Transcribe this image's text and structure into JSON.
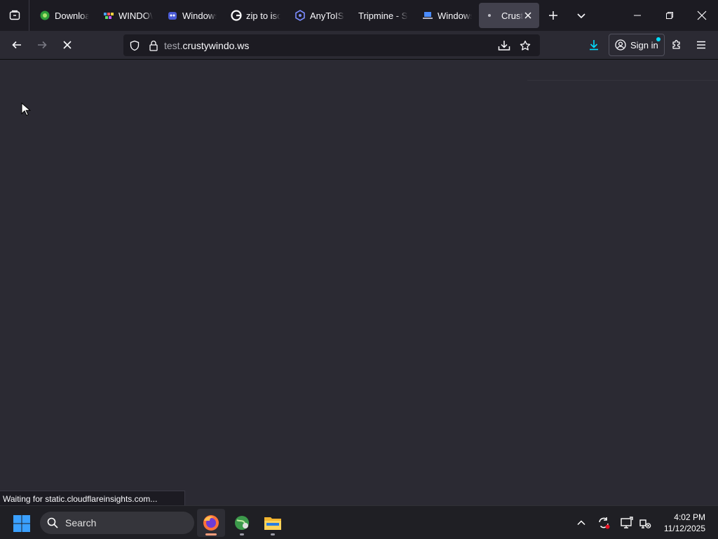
{
  "tabs": [
    {
      "label": "Download",
      "icon": "green-gear-favicon"
    },
    {
      "label": "WINDOWS",
      "icon": "colorful-favicon"
    },
    {
      "label": "Windows",
      "icon": "monster-favicon"
    },
    {
      "label": "zip to iso",
      "icon": "google-favicon"
    },
    {
      "label": "AnyToISO",
      "icon": "hexagon-favicon"
    },
    {
      "label": "Tripmine - So",
      "icon": ""
    },
    {
      "label": "Windows",
      "icon": "laptop-favicon"
    },
    {
      "label": "Crust",
      "icon": "loading-dot",
      "active": true
    }
  ],
  "url": {
    "subdomain": "test.",
    "host": "crustywindo.ws"
  },
  "toolbar": {
    "signin_label": "Sign in"
  },
  "status_text": "Waiting for static.cloudflareinsights.com...",
  "taskbar": {
    "search_label": "Search",
    "time": "4:02 PM",
    "date": "11/12/2025"
  },
  "colors": {
    "accent": "#00ddff",
    "download": "#00ddff",
    "firefox_indicator": "#ff9f7d"
  }
}
